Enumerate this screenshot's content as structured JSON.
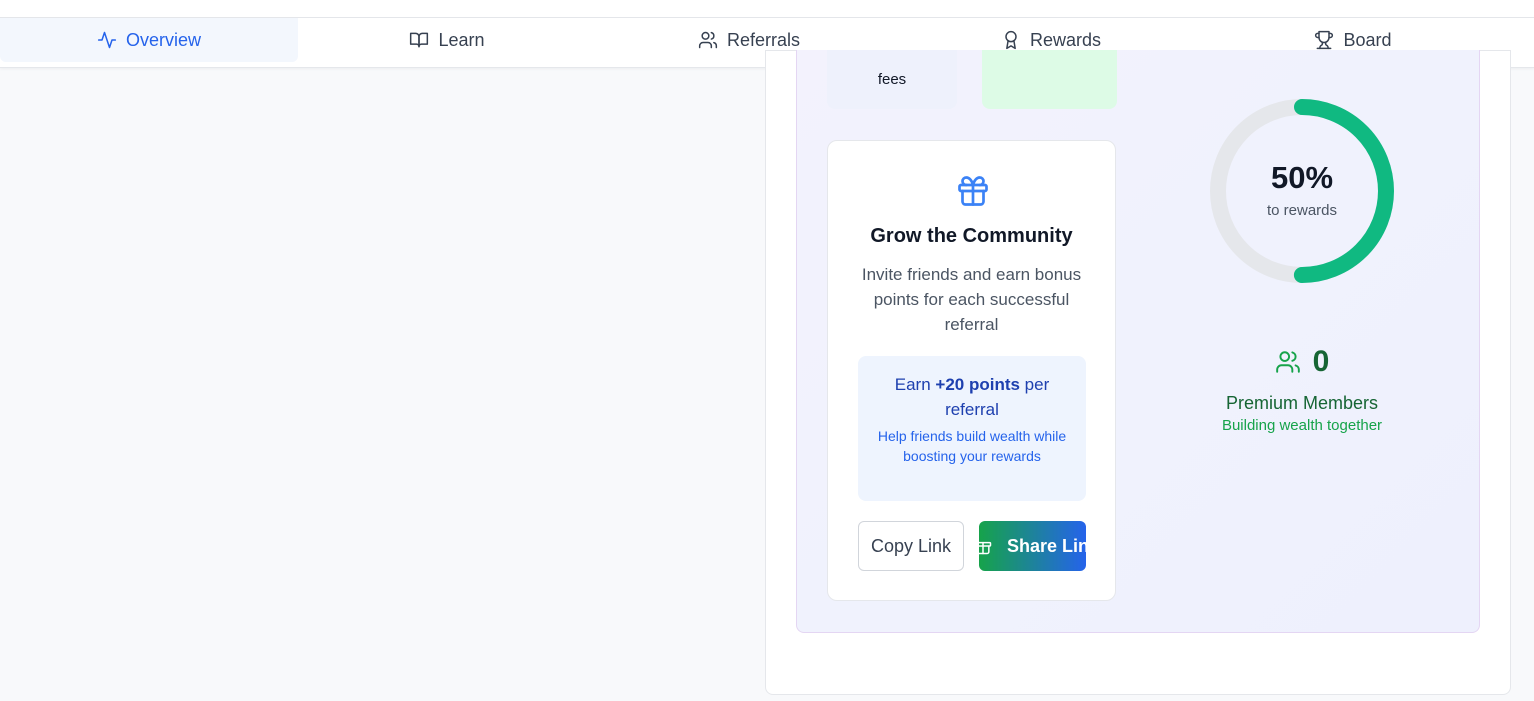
{
  "tabs": [
    {
      "label": "Overview",
      "icon": "activity-icon",
      "active": true
    },
    {
      "label": "Learn",
      "icon": "book-icon",
      "active": false
    },
    {
      "label": "Referrals",
      "icon": "users-icon",
      "active": false
    },
    {
      "label": "Rewards",
      "icon": "award-icon",
      "active": false
    },
    {
      "label": "Board",
      "icon": "trophy-icon",
      "active": false
    }
  ],
  "mini_stat": {
    "label": "fees"
  },
  "invite": {
    "icon": "gift-icon",
    "title": "Grow the Community",
    "description": "Invite friends and earn bonus points for each successful referral",
    "earn_prefix": "Earn ",
    "earn_points": "+20 points",
    "earn_suffix": " per referral",
    "earn_sub": "Help friends build wealth while boosting your rewards",
    "copy_label": "Copy Link",
    "share_label": "Share Lin"
  },
  "progress": {
    "percent_text": "50%",
    "value": 0.5,
    "label": "to rewards"
  },
  "members": {
    "count": "0",
    "title": "Premium Members",
    "subtitle": "Building wealth together"
  },
  "colors": {
    "accent_blue": "#2563eb",
    "accent_green": "#10b981",
    "dark_green": "#166534",
    "track_gray": "#e5e7eb"
  }
}
